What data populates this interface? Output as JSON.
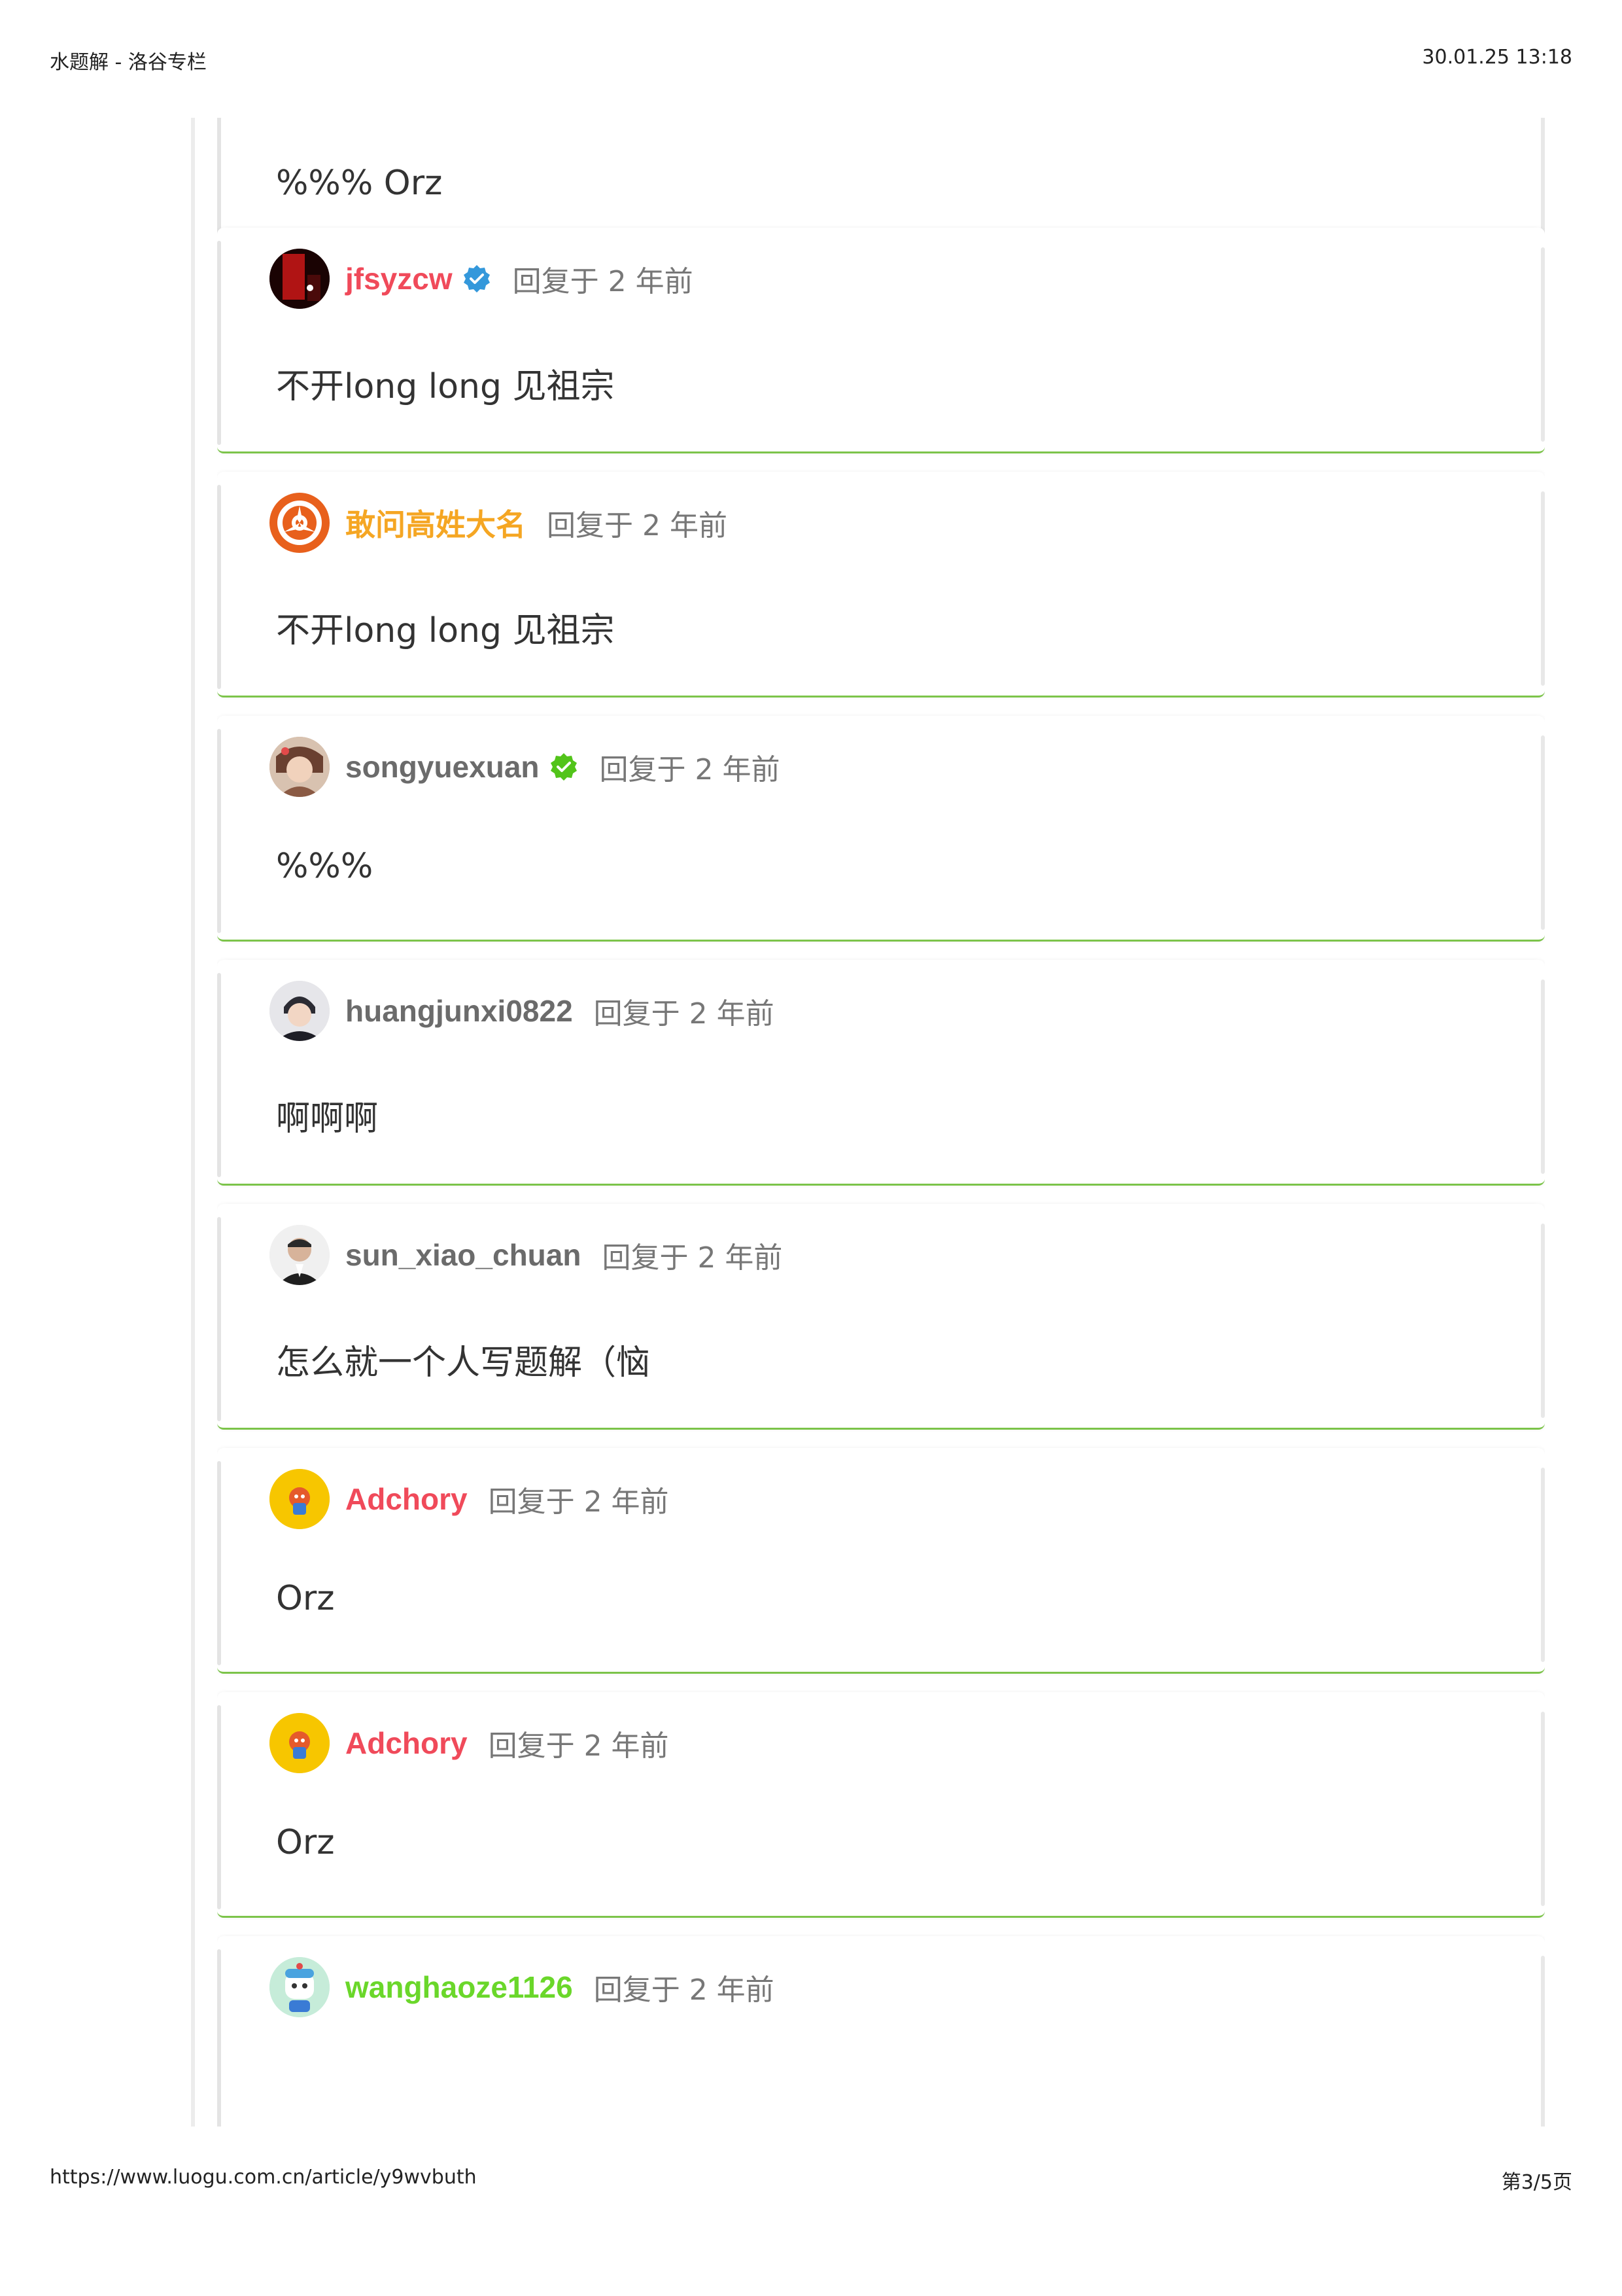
{
  "header": {
    "title": "水题解 - 洛谷专栏",
    "datetime": "30.01.25 13:18"
  },
  "footer": {
    "url": "https://www.luogu.com.cn/article/y9wvbuth",
    "page": "第3/5页"
  },
  "colors": {
    "red_name": "#f04a5a",
    "orange_name": "#f5a623",
    "gray_name": "#6b6b6b",
    "green_name": "#6ad72a",
    "card_border": "#7cc44a",
    "badge_blue": "#3498db",
    "badge_green": "#52c41a"
  },
  "comments": [
    {
      "user": "",
      "reply": "",
      "text": "%%% Orz",
      "avatar": "none",
      "badge": "none"
    },
    {
      "user": "jfsyzcw",
      "reply": "回复于 2 年前",
      "text": "不开long long 见祖宗",
      "avatar": "dark-red-portrait",
      "badge": "blue-check-icon"
    },
    {
      "user": "敢问高姓大名",
      "reply": "回复于 2 年前",
      "text": "不开long long 见祖宗",
      "avatar": "orange-wheel",
      "badge": "none"
    },
    {
      "user": "songyuexuan",
      "reply": "回复于 2 年前",
      "text": "%%%",
      "avatar": "anime-portrait",
      "badge": "green-check-icon"
    },
    {
      "user": "huangjunxi0822",
      "reply": "回复于 2 年前",
      "text": "啊啊啊",
      "avatar": "person-portrait",
      "badge": "none"
    },
    {
      "user": "sun_xiao_chuan",
      "reply": "回复于 2 年前",
      "text": "怎么就一个人写题解（恼",
      "avatar": "man-portrait",
      "badge": "none"
    },
    {
      "user": "Adchory",
      "reply": "回复于 2 年前",
      "text": "Orz",
      "avatar": "yellow-cartoon",
      "badge": "none"
    },
    {
      "user": "Adchory",
      "reply": "回复于 2 年前",
      "text": "Orz",
      "avatar": "yellow-cartoon",
      "badge": "none"
    },
    {
      "user": "wanghaoze1126",
      "reply": "回复于 2 年前",
      "text": "",
      "avatar": "blue-cartoon",
      "badge": "none"
    }
  ]
}
